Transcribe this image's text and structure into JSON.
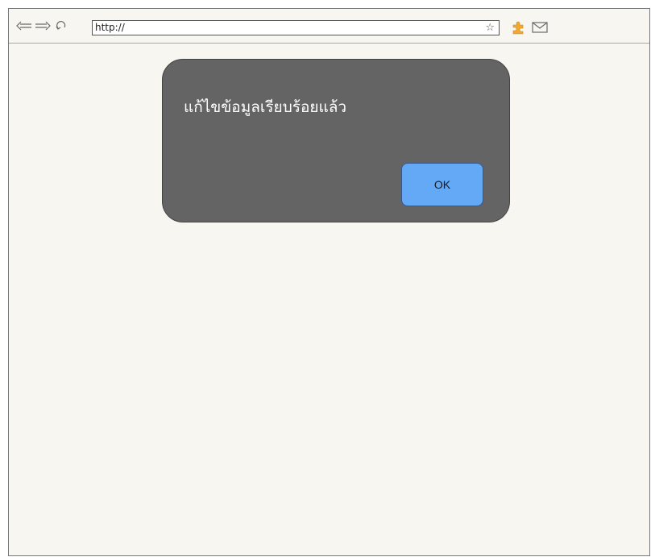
{
  "toolbar": {
    "back_icon": "back-arrow-icon",
    "forward_icon": "forward-arrow-icon",
    "reload_icon": "reload-icon",
    "url": "http://",
    "bookmark_icon": "star-icon",
    "bookmark_glyph": "☆",
    "extension_icon": "puzzle-piece-icon",
    "mail_icon": "envelope-icon"
  },
  "dialog": {
    "message": "แก้ไขข้อมูลเรียบร้อยแล้ว",
    "ok_label": "OK"
  },
  "colors": {
    "page_background": "#f8f6f1",
    "dialog_background": "#646464",
    "ok_button": "#64a9f6",
    "extension_icon": "#f0a830"
  }
}
